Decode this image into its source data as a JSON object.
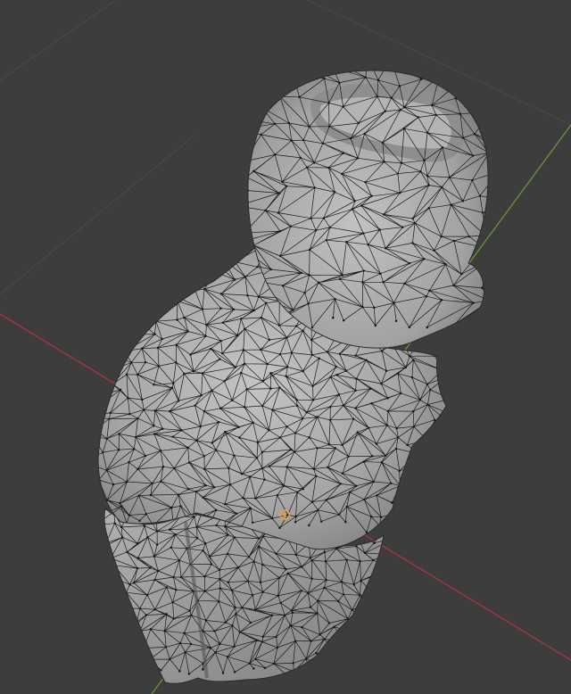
{
  "viewport": {
    "background": "#3d3d3d",
    "grid_color": "#4a4a4a",
    "x_axis_color": "#b3363f",
    "y_axis_color": "#6f9a2e",
    "mesh_fill": "#a8a8a8",
    "mesh_shadow": "#7e7e7e",
    "mesh_highlight": "#c4c4c4",
    "wire_color": "#1a1a1a",
    "origin_color": "#e8a13a",
    "origin_icon": "object-origin-icon"
  },
  "model": {
    "display_mode": "solid-wireframe"
  }
}
